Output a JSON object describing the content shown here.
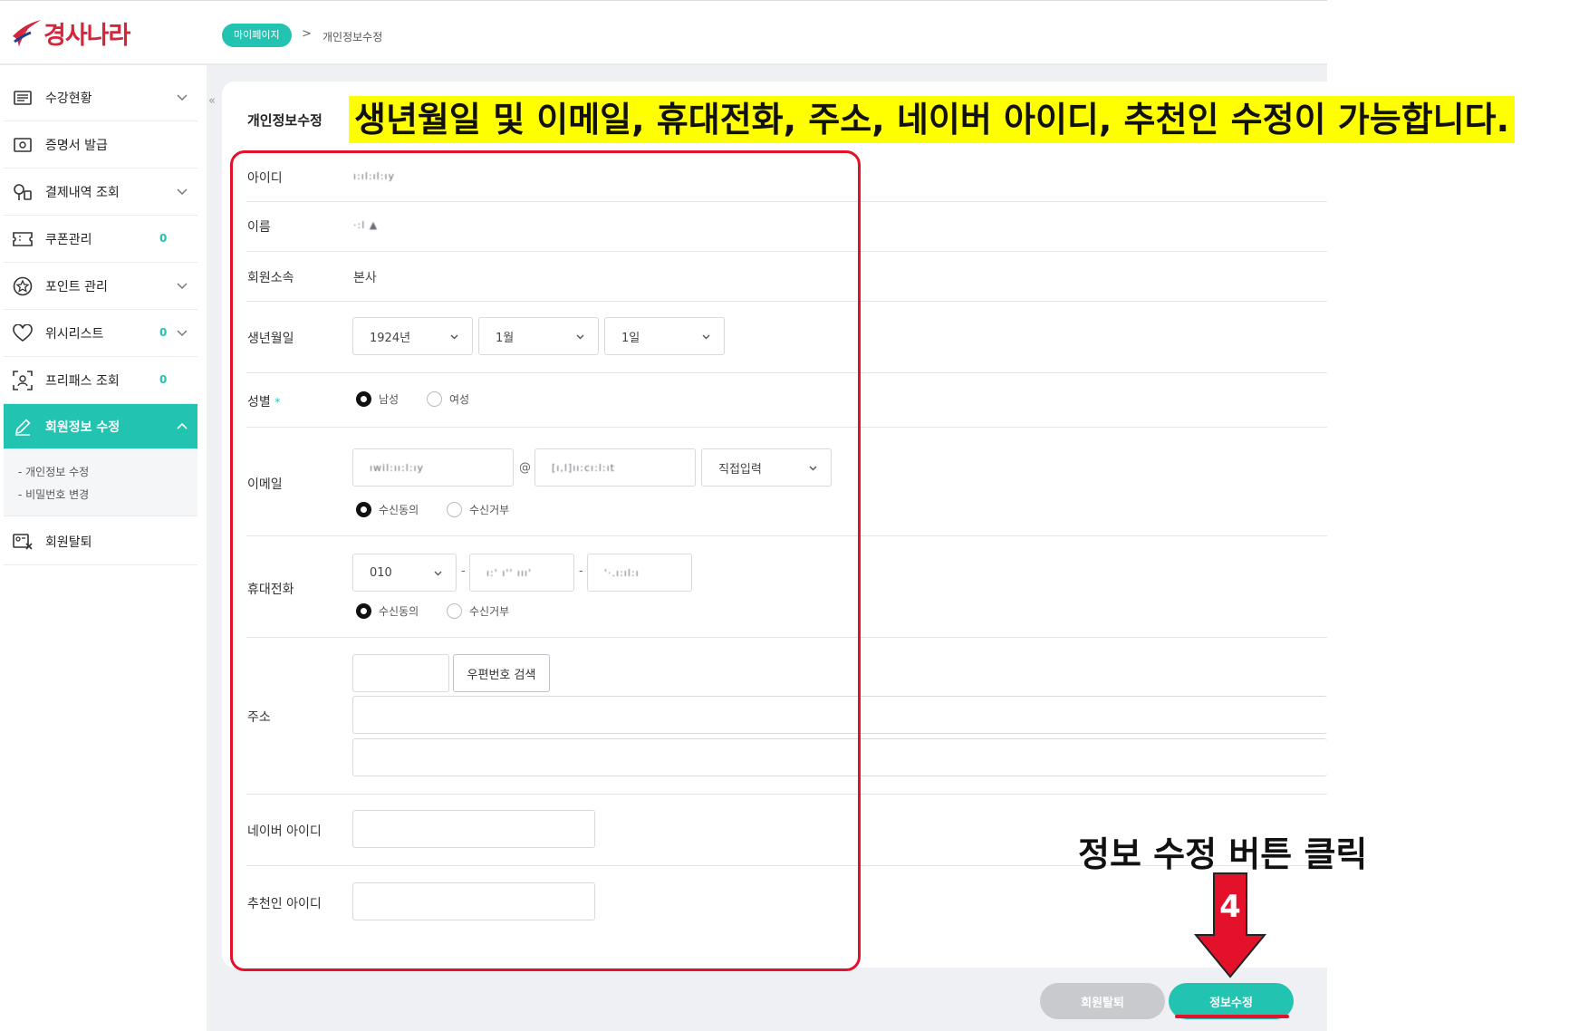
{
  "brand": {
    "logo_text": "경사나라",
    "accent": "#22c4b1",
    "brand_red": "#d6243a"
  },
  "breadcrumb": {
    "home": "마이페이지",
    "separator": ">",
    "current": "개인정보수정"
  },
  "sidebar": {
    "items": [
      {
        "label": "수강현황",
        "icon": "list-icon",
        "count": "",
        "has_chevron": true
      },
      {
        "label": "증명서 발급",
        "icon": "certificate-icon",
        "count": "",
        "has_chevron": false
      },
      {
        "label": "결제내역 조회",
        "icon": "payment-icon",
        "count": "",
        "has_chevron": true
      },
      {
        "label": "쿠폰관리",
        "icon": "coupon-icon",
        "count": "0",
        "has_chevron": false
      },
      {
        "label": "포인트 관리",
        "icon": "point-icon",
        "count": "",
        "has_chevron": true
      },
      {
        "label": "위시리스트",
        "icon": "heart-icon",
        "count": "0",
        "has_chevron": true
      },
      {
        "label": "프리패스 조회",
        "icon": "freepass-icon",
        "count": "0",
        "has_chevron": false
      },
      {
        "label": "회원정보 수정",
        "icon": "pencil-icon",
        "count": "",
        "has_chevron": true,
        "active": true
      },
      {
        "label": "회원탈퇴",
        "icon": "withdraw-icon",
        "count": "",
        "has_chevron": false
      }
    ],
    "submenu": [
      "- 개인정보 수정",
      "- 비밀번호 변경"
    ],
    "collapse_glyph": "«"
  },
  "form": {
    "title": "개인정보수정",
    "id": {
      "label": "아이디",
      "value": "ı:ıl:ıl:ıy"
    },
    "name": {
      "label": "이름",
      "value": "·:l ▲"
    },
    "affiliation": {
      "label": "회원소속",
      "value": "본사"
    },
    "birth": {
      "label": "생년월일",
      "year": "1924년",
      "month": "1월",
      "day": "1일"
    },
    "gender": {
      "label": "성별",
      "required_mark": "*",
      "options": [
        "남성",
        "여성"
      ],
      "selected": "남성"
    },
    "email": {
      "label": "이메일",
      "local": "ıwil:ıı:l:ıy",
      "at": "@",
      "domain": "[ı,l]ıı:cı:l:ıt",
      "domain_select": "직접입력",
      "consent_options": [
        "수신동의",
        "수신거부"
      ],
      "consent_selected": "수신동의"
    },
    "phone": {
      "label": "휴대전화",
      "prefix": "010",
      "mid": "ı:' ı'' ııı'",
      "last": "'·.ı:ıl:ı",
      "dash": "-",
      "consent_options": [
        "수신동의",
        "수신거부"
      ],
      "consent_selected": "수신동의"
    },
    "address": {
      "label": "주소",
      "zip_value": "",
      "search_button": "우편번호 검색",
      "line1": "",
      "line2": ""
    },
    "naver": {
      "label": "네이버 아이디",
      "value": ""
    },
    "referrer": {
      "label": "추천인 아이디",
      "value": ""
    }
  },
  "annotations": {
    "headline": "생년월일 및 이메일, 휴대전화, 주소, 네이버 아이디, 추천인 수정이 가능합니다.",
    "note": "정보 수정 버튼 클릭",
    "step_number": "4",
    "highlight_color": "#ffff00",
    "marker_color": "#e3122a"
  },
  "actions": {
    "withdraw_button": "회원탈퇴",
    "submit_button": "정보수정"
  }
}
